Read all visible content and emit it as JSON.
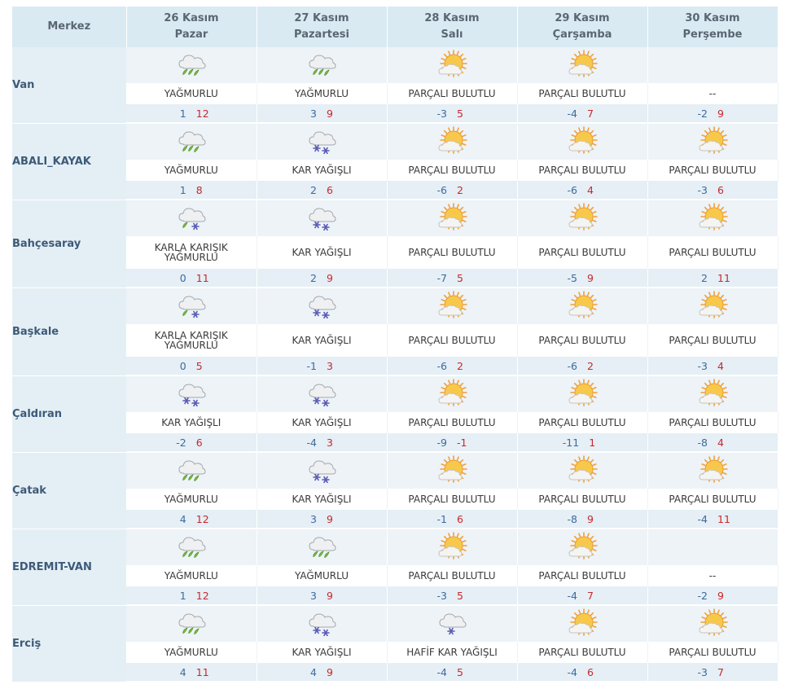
{
  "header": {
    "location_label": "Merkez",
    "days": [
      {
        "date": "26 Kasım",
        "weekday": "Pazar"
      },
      {
        "date": "27 Kasım",
        "weekday": "Pazartesi"
      },
      {
        "date": "28 Kasım",
        "weekday": "Salı"
      },
      {
        "date": "29 Kasım",
        "weekday": "Çarşamba"
      },
      {
        "date": "30 Kasım",
        "weekday": "Perşembe"
      }
    ]
  },
  "rows": [
    {
      "name": "Van",
      "days": [
        {
          "icon": "rain",
          "desc": "YAĞMURLU",
          "min": "1",
          "max": "12"
        },
        {
          "icon": "rain",
          "desc": "YAĞMURLU",
          "min": "3",
          "max": "9"
        },
        {
          "icon": "partly-cloudy",
          "desc": "PARÇALI BULUTLU",
          "min": "-3",
          "max": "5"
        },
        {
          "icon": "partly-cloudy",
          "desc": "PARÇALI BULUTLU",
          "min": "-4",
          "max": "7"
        },
        {
          "icon": "none",
          "desc": "--",
          "min": "-2",
          "max": "9"
        }
      ]
    },
    {
      "name": "ABALI_KAYAK",
      "days": [
        {
          "icon": "rain",
          "desc": "YAĞMURLU",
          "min": "1",
          "max": "8"
        },
        {
          "icon": "snow",
          "desc": "KAR YAĞIŞLI",
          "min": "2",
          "max": "6"
        },
        {
          "icon": "partly-cloudy",
          "desc": "PARÇALI BULUTLU",
          "min": "-6",
          "max": "2"
        },
        {
          "icon": "partly-cloudy",
          "desc": "PARÇALI BULUTLU",
          "min": "-6",
          "max": "4"
        },
        {
          "icon": "partly-cloudy",
          "desc": "PARÇALI BULUTLU",
          "min": "-3",
          "max": "6"
        }
      ]
    },
    {
      "name": "Bahçesaray",
      "tall": true,
      "days": [
        {
          "icon": "sleet",
          "desc": "KARLA KARIŞIK",
          "desc2": "YAĞMURLU",
          "min": "0",
          "max": "11"
        },
        {
          "icon": "snow",
          "desc": "KAR YAĞIŞLI",
          "min": "2",
          "max": "9"
        },
        {
          "icon": "partly-cloudy",
          "desc": "PARÇALI BULUTLU",
          "min": "-7",
          "max": "5"
        },
        {
          "icon": "partly-cloudy",
          "desc": "PARÇALI BULUTLU",
          "min": "-5",
          "max": "9"
        },
        {
          "icon": "partly-cloudy",
          "desc": "PARÇALI BULUTLU",
          "min": "2",
          "max": "11"
        }
      ]
    },
    {
      "name": "Başkale",
      "tall": true,
      "days": [
        {
          "icon": "sleet",
          "desc": "KARLA KARIŞIK",
          "desc2": "YAĞMURLU",
          "min": "0",
          "max": "5"
        },
        {
          "icon": "snow",
          "desc": "KAR YAĞIŞLI",
          "min": "-1",
          "max": "3"
        },
        {
          "icon": "partly-cloudy",
          "desc": "PARÇALI BULUTLU",
          "min": "-6",
          "max": "2"
        },
        {
          "icon": "partly-cloudy",
          "desc": "PARÇALI BULUTLU",
          "min": "-6",
          "max": "2"
        },
        {
          "icon": "partly-cloudy",
          "desc": "PARÇALI BULUTLU",
          "min": "-3",
          "max": "4"
        }
      ]
    },
    {
      "name": "Çaldıran",
      "days": [
        {
          "icon": "snow",
          "desc": "KAR YAĞIŞLI",
          "min": "-2",
          "max": "6"
        },
        {
          "icon": "snow",
          "desc": "KAR YAĞIŞLI",
          "min": "-4",
          "max": "3"
        },
        {
          "icon": "partly-cloudy",
          "desc": "PARÇALI BULUTLU",
          "min": "-9",
          "max": "-1"
        },
        {
          "icon": "partly-cloudy",
          "desc": "PARÇALI BULUTLU",
          "min": "-11",
          "max": "1"
        },
        {
          "icon": "partly-cloudy",
          "desc": "PARÇALI BULUTLU",
          "min": "-8",
          "max": "4"
        }
      ]
    },
    {
      "name": "Çatak",
      "days": [
        {
          "icon": "rain",
          "desc": "YAĞMURLU",
          "min": "4",
          "max": "12"
        },
        {
          "icon": "snow",
          "desc": "KAR YAĞIŞLI",
          "min": "3",
          "max": "9"
        },
        {
          "icon": "partly-cloudy",
          "desc": "PARÇALI BULUTLU",
          "min": "-1",
          "max": "6"
        },
        {
          "icon": "partly-cloudy",
          "desc": "PARÇALI BULUTLU",
          "min": "-8",
          "max": "9"
        },
        {
          "icon": "partly-cloudy",
          "desc": "PARÇALI BULUTLU",
          "min": "-4",
          "max": "11"
        }
      ]
    },
    {
      "name": "EDREMIT-VAN",
      "days": [
        {
          "icon": "rain",
          "desc": "YAĞMURLU",
          "min": "1",
          "max": "12"
        },
        {
          "icon": "rain",
          "desc": "YAĞMURLU",
          "min": "3",
          "max": "9"
        },
        {
          "icon": "partly-cloudy",
          "desc": "PARÇALI BULUTLU",
          "min": "-3",
          "max": "5"
        },
        {
          "icon": "partly-cloudy",
          "desc": "PARÇALI BULUTLU",
          "min": "-4",
          "max": "7"
        },
        {
          "icon": "none",
          "desc": "--",
          "min": "-2",
          "max": "9"
        }
      ]
    },
    {
      "name": "Erciş",
      "days": [
        {
          "icon": "rain",
          "desc": "YAĞMURLU",
          "min": "4",
          "max": "11"
        },
        {
          "icon": "snow",
          "desc": "KAR YAĞIŞLI",
          "min": "4",
          "max": "9"
        },
        {
          "icon": "light-snow",
          "desc": "HAFİF KAR YAĞIŞLI",
          "min": "-4",
          "max": "5"
        },
        {
          "icon": "partly-cloudy",
          "desc": "PARÇALI BULUTLU",
          "min": "-4",
          "max": "6"
        },
        {
          "icon": "partly-cloudy",
          "desc": "PARÇALI BULUTLU",
          "min": "-3",
          "max": "7"
        }
      ]
    }
  ],
  "colors": {
    "header_bg": "#daeaf3",
    "min_temp": "#3d6aa0",
    "max_temp": "#c8282e",
    "location_text": "#3d5a78"
  }
}
